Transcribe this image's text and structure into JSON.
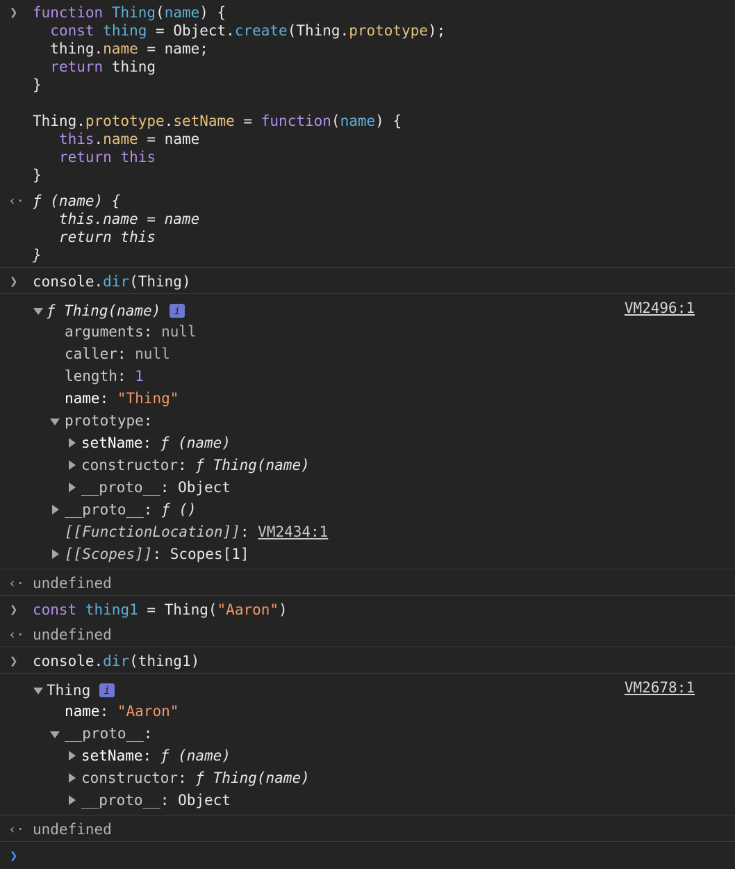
{
  "icons": {
    "input_prompt": "chevron-right-icon",
    "output_arrow": "return-arrow-icon",
    "expand_open": "triangle-down-icon",
    "expand_closed": "triangle-right-icon",
    "info": "info-icon"
  },
  "colors": {
    "background": "#242424",
    "keyword": "#b08ee8",
    "function_name": "#5db0d7",
    "property": "#e6c07b",
    "string": "#f29766",
    "number": "#9b94f6",
    "active_prompt": "#4a8df8"
  },
  "entry1": {
    "l1": {
      "a": "function",
      "b": " ",
      "c": "Thing",
      "d": "(",
      "e": "name",
      "f": ") {"
    },
    "l2": {
      "a": "  ",
      "b": "const",
      "c": " ",
      "d": "thing",
      "e": " = Object.",
      "f": "create",
      "g": "(Thing.",
      "h": "prototype",
      "i": ");"
    },
    "l3": {
      "a": "  thing.",
      "b": "name",
      "c": " = name;"
    },
    "l4": {
      "a": "  ",
      "b": "return",
      "c": " thing"
    },
    "l5": "}",
    "l7": {
      "a": "Thing.",
      "b": "prototype",
      "c": ".",
      "d": "setName",
      "e": " = ",
      "f": "function",
      "g": "(",
      "h": "name",
      "i": ") {"
    },
    "l8": {
      "a": "   ",
      "b": "this",
      "c": ".",
      "d": "name",
      "e": " = name"
    },
    "l9": {
      "a": "   ",
      "b": "return",
      "c": " ",
      "d": "this"
    },
    "l10": "}"
  },
  "result1": {
    "l1": "ƒ (name) {",
    "l2": "   this.name = name",
    "l3": "   return this",
    "l4": "}"
  },
  "entry2": {
    "a": "console.",
    "b": "dir",
    "c": "(Thing)"
  },
  "dir1": {
    "head": "ƒ Thing(name)",
    "vm": "VM2496:1",
    "arguments": {
      "k": "arguments",
      "v": "null"
    },
    "caller": {
      "k": "caller",
      "v": "null"
    },
    "length": {
      "k": "length",
      "v": "1"
    },
    "name": {
      "k": "name",
      "v": "\"Thing\""
    },
    "prototype": {
      "k": "prototype"
    },
    "setName": {
      "k": "setName",
      "v": "ƒ (name)"
    },
    "constructor": {
      "k": "constructor",
      "v": "ƒ Thing(name)"
    },
    "proto_inner": {
      "k": "__proto__",
      "v": "Object"
    },
    "proto": {
      "k": "__proto__",
      "v": "ƒ ()"
    },
    "function_location": {
      "k": "[[FunctionLocation]]",
      "v": "VM2434:1"
    },
    "scopes": {
      "k": "[[Scopes]]",
      "v": "Scopes[1]"
    }
  },
  "result2": "undefined",
  "entry3": {
    "a": "const",
    "b": " ",
    "c": "thing1",
    "d": " = Thing(",
    "e": "\"Aaron\"",
    "f": ")"
  },
  "result3": "undefined",
  "entry4": {
    "a": "console.",
    "b": "dir",
    "c": "(thing1)"
  },
  "dir2": {
    "head": "Thing",
    "vm": "VM2678:1",
    "name": {
      "k": "name",
      "v": "\"Aaron\""
    },
    "proto": {
      "k": "__proto__"
    },
    "setName": {
      "k": "setName",
      "v": "ƒ (name)"
    },
    "constructor": {
      "k": "constructor",
      "v": "ƒ Thing(name)"
    },
    "proto_inner": {
      "k": "__proto__",
      "v": "Object"
    }
  },
  "result4": "undefined",
  "info_glyph": "i",
  "prompt_glyph": ">",
  "output_glyph": "<·"
}
